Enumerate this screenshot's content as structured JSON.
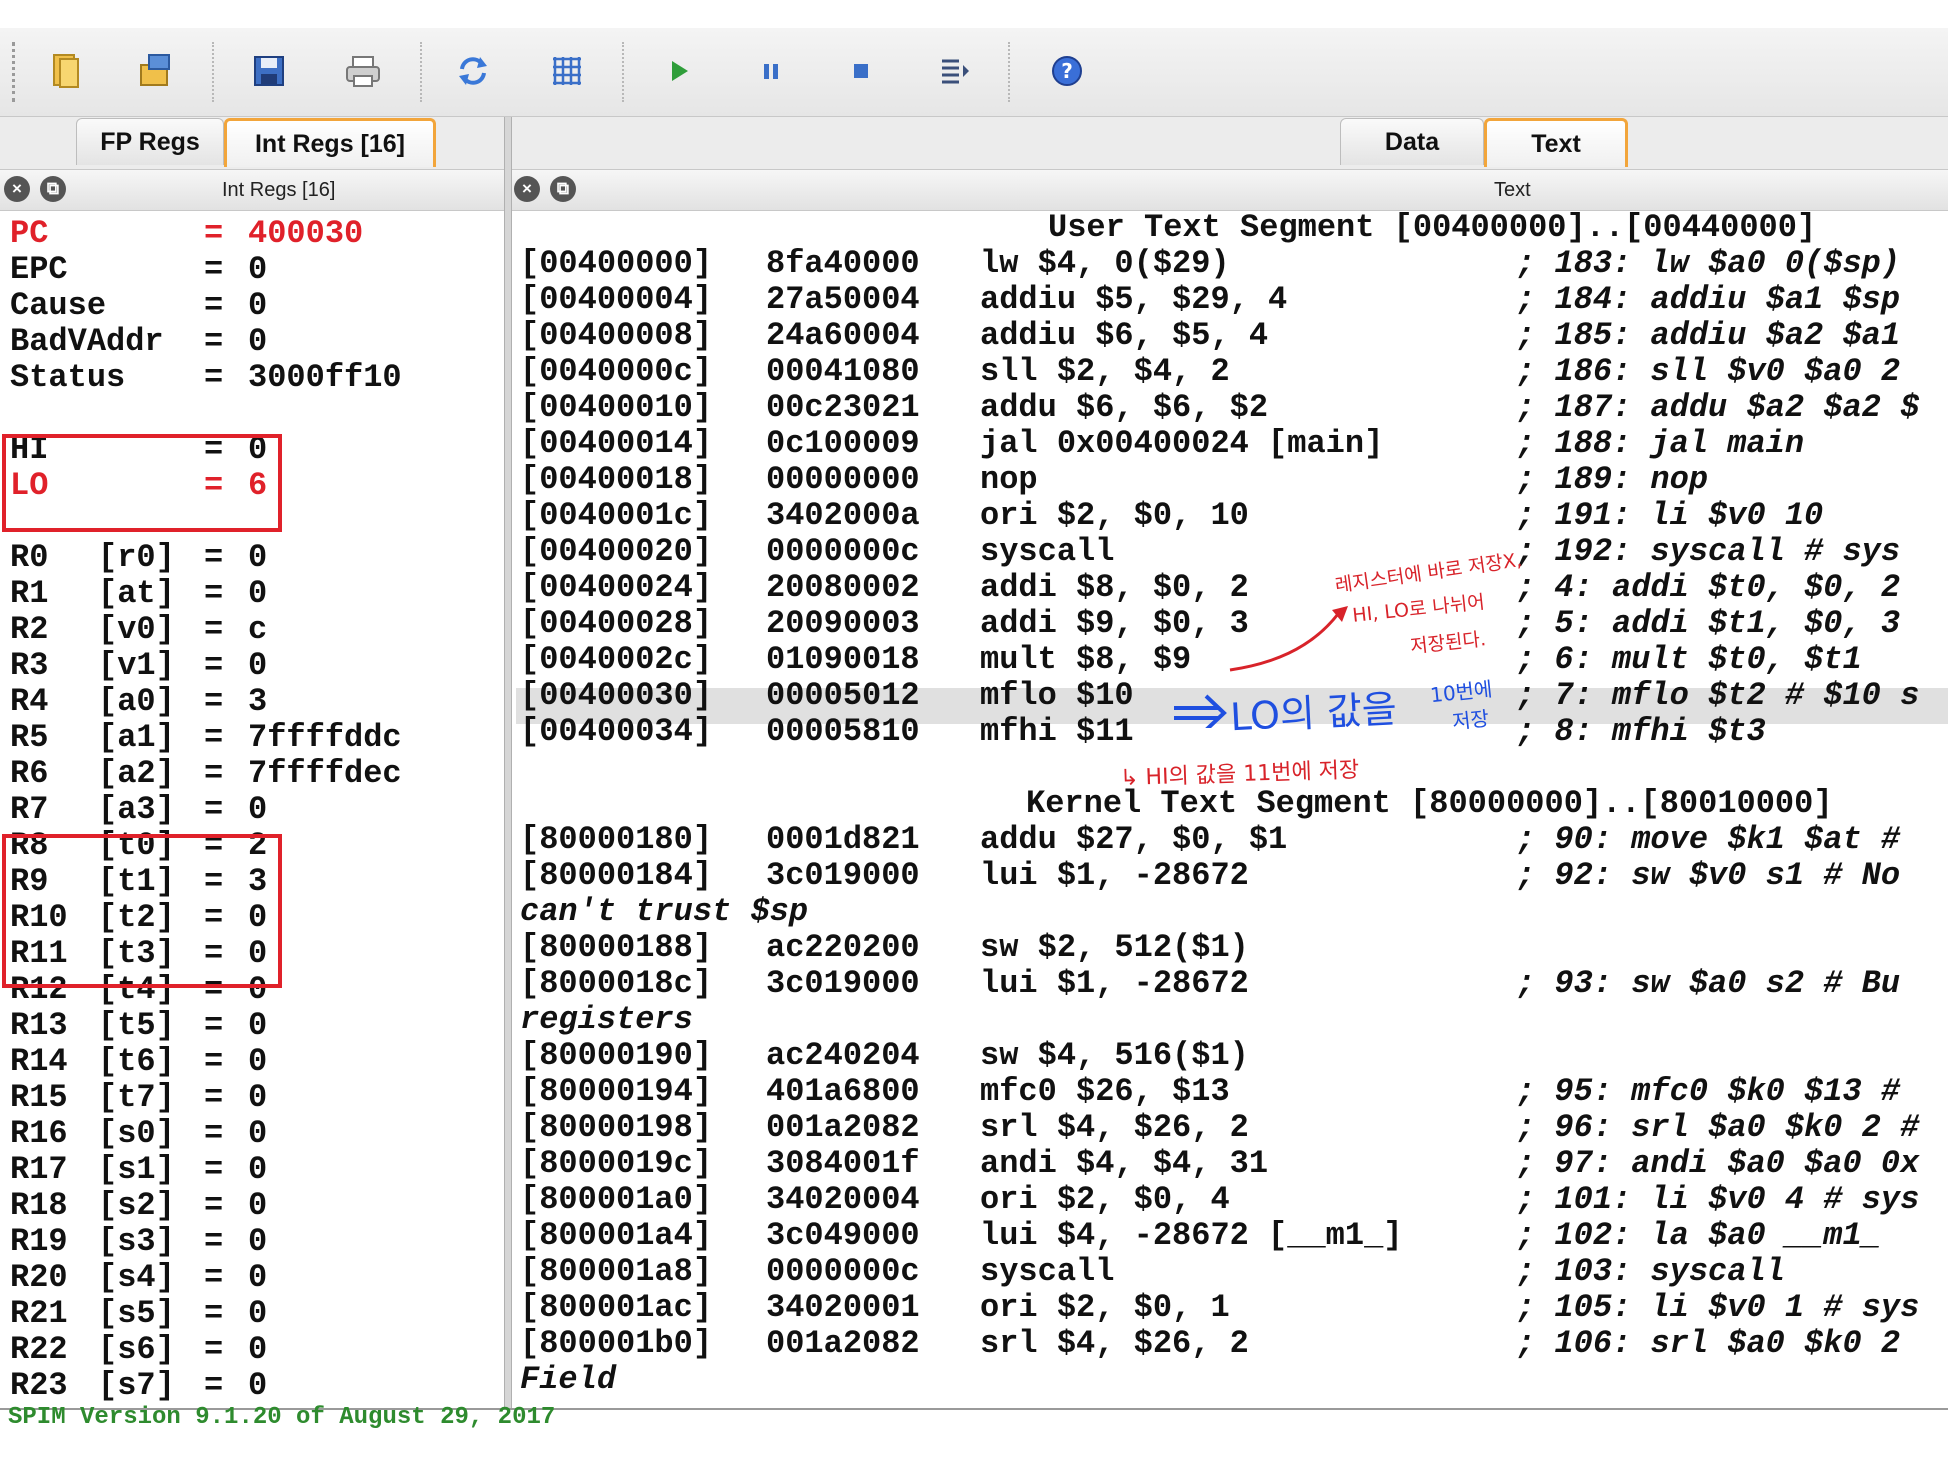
{
  "toolbar": {
    "buttons": [
      "open-icon",
      "reload-file-icon",
      "save-icon",
      "print-icon",
      "reinitialize-icon",
      "clear-registers-icon",
      "run-icon",
      "pause-icon",
      "stop-icon",
      "single-step-icon",
      "help-icon"
    ]
  },
  "left_tabs": [
    "FP Regs",
    "Int Regs [16]"
  ],
  "left_active_tab": "Int Regs [16]",
  "left_pane_title": "Int Regs [16]",
  "right_tabs": [
    "Data",
    "Text"
  ],
  "right_active_tab": "Text",
  "right_pane_title": "Text",
  "special_regs": [
    {
      "name": "PC",
      "eq": "=",
      "value": "400030"
    },
    {
      "name": "EPC",
      "eq": "=",
      "value": "0"
    },
    {
      "name": "Cause",
      "eq": "=",
      "value": "0"
    },
    {
      "name": "BadVAddr",
      "eq": "=",
      "value": "0"
    },
    {
      "name": "Status",
      "eq": "=",
      "value": "3000ff10"
    },
    {
      "name": "HI",
      "eq": "=",
      "value": "0"
    },
    {
      "name": "LO",
      "eq": "=",
      "value": "6"
    }
  ],
  "gp_regs": [
    {
      "name": "R0",
      "alias": "[r0]",
      "value": "0"
    },
    {
      "name": "R1",
      "alias": "[at]",
      "value": "0"
    },
    {
      "name": "R2",
      "alias": "[v0]",
      "value": "c"
    },
    {
      "name": "R3",
      "alias": "[v1]",
      "value": "0"
    },
    {
      "name": "R4",
      "alias": "[a0]",
      "value": "3"
    },
    {
      "name": "R5",
      "alias": "[a1]",
      "value": "7ffffddc"
    },
    {
      "name": "R6",
      "alias": "[a2]",
      "value": "7ffffdec"
    },
    {
      "name": "R7",
      "alias": "[a3]",
      "value": "0"
    },
    {
      "name": "R8",
      "alias": "[t0]",
      "value": "2"
    },
    {
      "name": "R9",
      "alias": "[t1]",
      "value": "3"
    },
    {
      "name": "R10",
      "alias": "[t2]",
      "value": "0"
    },
    {
      "name": "R11",
      "alias": "[t3]",
      "value": "0"
    },
    {
      "name": "R12",
      "alias": "[t4]",
      "value": "0"
    },
    {
      "name": "R13",
      "alias": "[t5]",
      "value": "0"
    },
    {
      "name": "R14",
      "alias": "[t6]",
      "value": "0"
    },
    {
      "name": "R15",
      "alias": "[t7]",
      "value": "0"
    },
    {
      "name": "R16",
      "alias": "[s0]",
      "value": "0"
    },
    {
      "name": "R17",
      "alias": "[s1]",
      "value": "0"
    },
    {
      "name": "R18",
      "alias": "[s2]",
      "value": "0"
    },
    {
      "name": "R19",
      "alias": "[s3]",
      "value": "0"
    },
    {
      "name": "R20",
      "alias": "[s4]",
      "value": "0"
    },
    {
      "name": "R21",
      "alias": "[s5]",
      "value": "0"
    },
    {
      "name": "R22",
      "alias": "[s6]",
      "value": "0"
    },
    {
      "name": "R23",
      "alias": "[s7]",
      "value": "0"
    }
  ],
  "user_text_title": "User Text Segment [00400000]..[00440000]",
  "user_text": [
    {
      "addr": "[00400000]",
      "hex": "8fa40000",
      "ins": "lw $4, 0($29)",
      "src": "; 183: lw $a0 0($sp)"
    },
    {
      "addr": "[00400004]",
      "hex": "27a50004",
      "ins": "addiu $5, $29, 4",
      "src": "; 184: addiu $a1 $sp"
    },
    {
      "addr": "[00400008]",
      "hex": "24a60004",
      "ins": "addiu $6, $5, 4",
      "src": "; 185: addiu $a2 $a1"
    },
    {
      "addr": "[0040000c]",
      "hex": "00041080",
      "ins": "sll $2, $4, 2",
      "src": "; 186: sll $v0 $a0 2"
    },
    {
      "addr": "[00400010]",
      "hex": "00c23021",
      "ins": "addu $6, $6, $2",
      "src": "; 187: addu $a2 $a2 $"
    },
    {
      "addr": "[00400014]",
      "hex": "0c100009",
      "ins": "jal 0x00400024 [main]",
      "src": "; 188: jal main"
    },
    {
      "addr": "[00400018]",
      "hex": "00000000",
      "ins": "nop",
      "src": "; 189: nop"
    },
    {
      "addr": "[0040001c]",
      "hex": "3402000a",
      "ins": "ori $2, $0, 10",
      "src": "; 191: li $v0 10"
    },
    {
      "addr": "[00400020]",
      "hex": "0000000c",
      "ins": "syscall",
      "src": "; 192: syscall # sys"
    },
    {
      "addr": "[00400024]",
      "hex": "20080002",
      "ins": "addi $8, $0, 2",
      "src": "; 4: addi $t0, $0, 2"
    },
    {
      "addr": "[00400028]",
      "hex": "20090003",
      "ins": "addi $9, $0, 3",
      "src": "; 5: addi $t1, $0, 3"
    },
    {
      "addr": "[0040002c]",
      "hex": "01090018",
      "ins": "mult $8, $9",
      "src": "; 6: mult $t0, $t1"
    },
    {
      "addr": "[00400030]",
      "hex": "00005012",
      "ins": "mflo $10",
      "src": "; 7: mflo $t2 # $10 s"
    },
    {
      "addr": "[00400034]",
      "hex": "00005810",
      "ins": "mfhi $11",
      "src": "; 8: mfhi $t3"
    }
  ],
  "kernel_text_title": "Kernel Text Segment [80000000]..[80010000]",
  "kernel_text": [
    {
      "addr": "[80000180]",
      "hex": "0001d821",
      "ins": "addu $27, $0, $1",
      "src": "; 90: move $k1 $at #"
    },
    {
      "addr": "[80000184]",
      "hex": "3c019000",
      "ins": "lui $1, -28672",
      "src": "; 92: sw $v0 s1 # No"
    },
    {
      "full": "can't trust $sp"
    },
    {
      "addr": "[80000188]",
      "hex": "ac220200",
      "ins": "sw $2, 512($1)",
      "src": ""
    },
    {
      "addr": "[8000018c]",
      "hex": "3c019000",
      "ins": "lui $1, -28672",
      "src": "; 93: sw $a0 s2 # Bu"
    },
    {
      "full": "registers"
    },
    {
      "addr": "[80000190]",
      "hex": "ac240204",
      "ins": "sw $4, 516($1)",
      "src": ""
    },
    {
      "addr": "[80000194]",
      "hex": "401a6800",
      "ins": "mfc0 $26, $13",
      "src": "; 95: mfc0 $k0 $13 #"
    },
    {
      "addr": "[80000198]",
      "hex": "001a2082",
      "ins": "srl $4, $26, 2",
      "src": "; 96: srl $a0 $k0 2 #"
    },
    {
      "addr": "[8000019c]",
      "hex": "3084001f",
      "ins": "andi $4, $4, 31",
      "src": "; 97: andi $a0 $a0 0x"
    },
    {
      "addr": "[800001a0]",
      "hex": "34020004",
      "ins": "ori $2, $0, 4",
      "src": "; 101: li $v0 4 # sys"
    },
    {
      "addr": "[800001a4]",
      "hex": "3c049000",
      "ins": "lui $4, -28672 [__m1_]",
      "src": "; 102: la $a0 __m1_"
    },
    {
      "addr": "[800001a8]",
      "hex": "0000000c",
      "ins": "syscall",
      "src": "; 103: syscall"
    },
    {
      "addr": "[800001ac]",
      "hex": "34020001",
      "ins": "ori $2, $0, 1",
      "src": "; 105: li $v0 1 # sys"
    },
    {
      "addr": "[800001b0]",
      "hex": "001a2082",
      "ins": "srl $4, $26, 2",
      "src": "; 106: srl $a0 $k0 2"
    },
    {
      "full": "Field"
    }
  ],
  "status_message": "SPIM Version 9.1.20 of August 29, 2017",
  "handwritten_notes": {
    "note1_line1": "레지스터에 바로 저장X,",
    "note1_line2": "HI, LO로 나뉘어",
    "note1_line3": "저장된다.",
    "note2": "LO의 값을",
    "note3_line1": "10번에",
    "note3_line2": "저장",
    "note4": "HI의 값을 11번에 저장",
    "note_colors": {
      "red": "#d8232a",
      "blue": "#1f4fe0"
    }
  },
  "colors": {
    "red_text": "#e0212a",
    "tab_highlight": "#f2a53b",
    "status_green": "#2e8b2e",
    "highlight_row": "#e0e0e0"
  }
}
